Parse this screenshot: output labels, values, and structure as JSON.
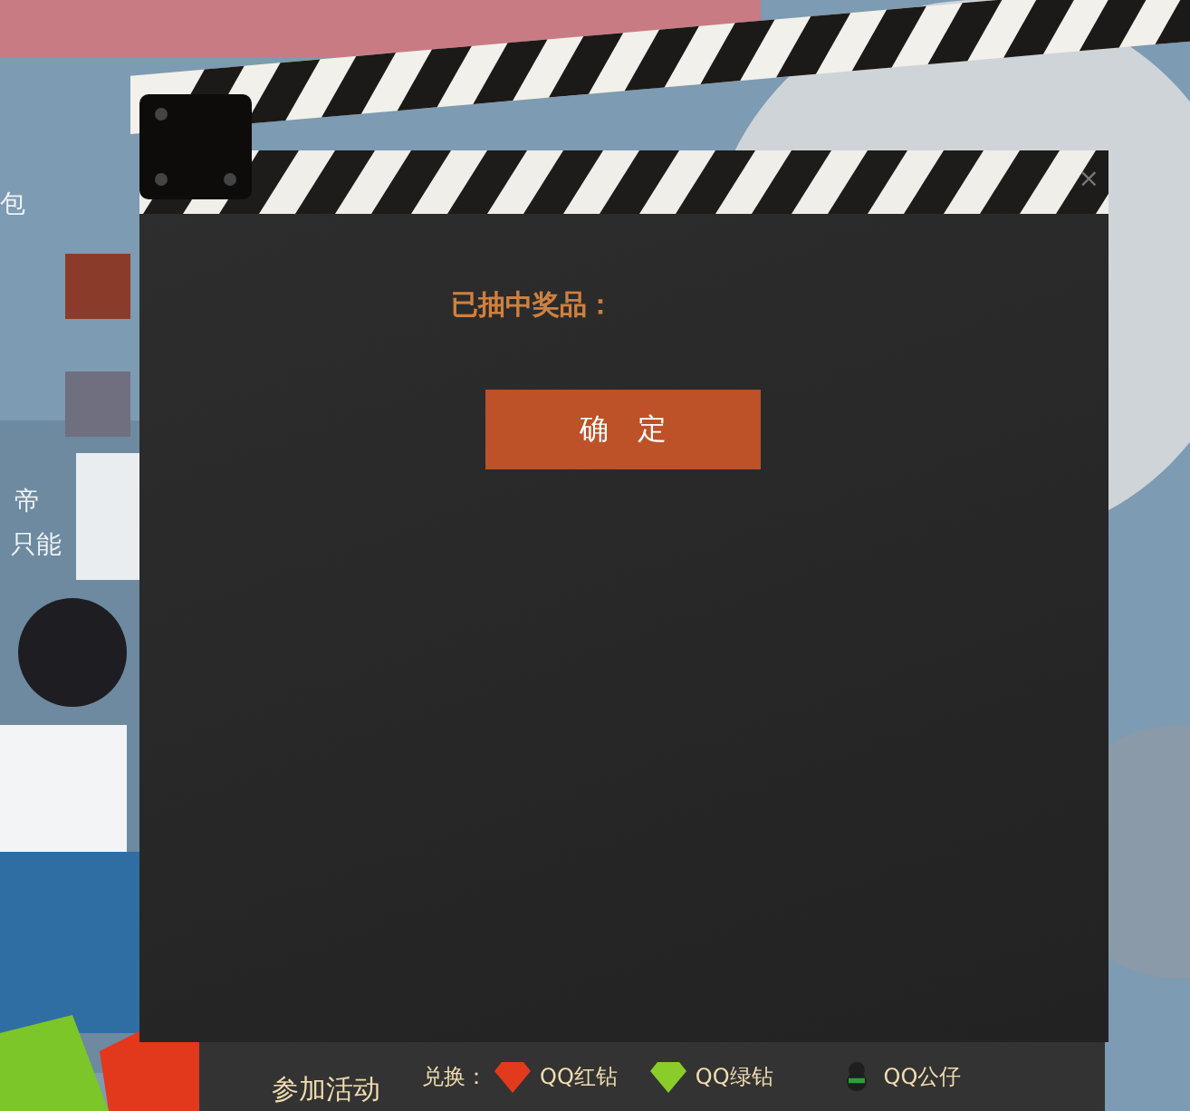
{
  "background": {
    "kind": "picture",
    "texts": [
      "包",
      "帝",
      "只能"
    ]
  },
  "dialog": {
    "close": "×",
    "prize_label": "已抽中奖品：",
    "confirm_button": "确　定"
  },
  "footer": {
    "join_label": "参加活动",
    "exchange_label": "兑换：",
    "items": [
      {
        "kind": "red-gem",
        "label": "QQ红钻"
      },
      {
        "kind": "green-gem",
        "label": "QQ绿钻"
      },
      {
        "kind": "mascot",
        "label": "QQ公仔"
      }
    ]
  }
}
